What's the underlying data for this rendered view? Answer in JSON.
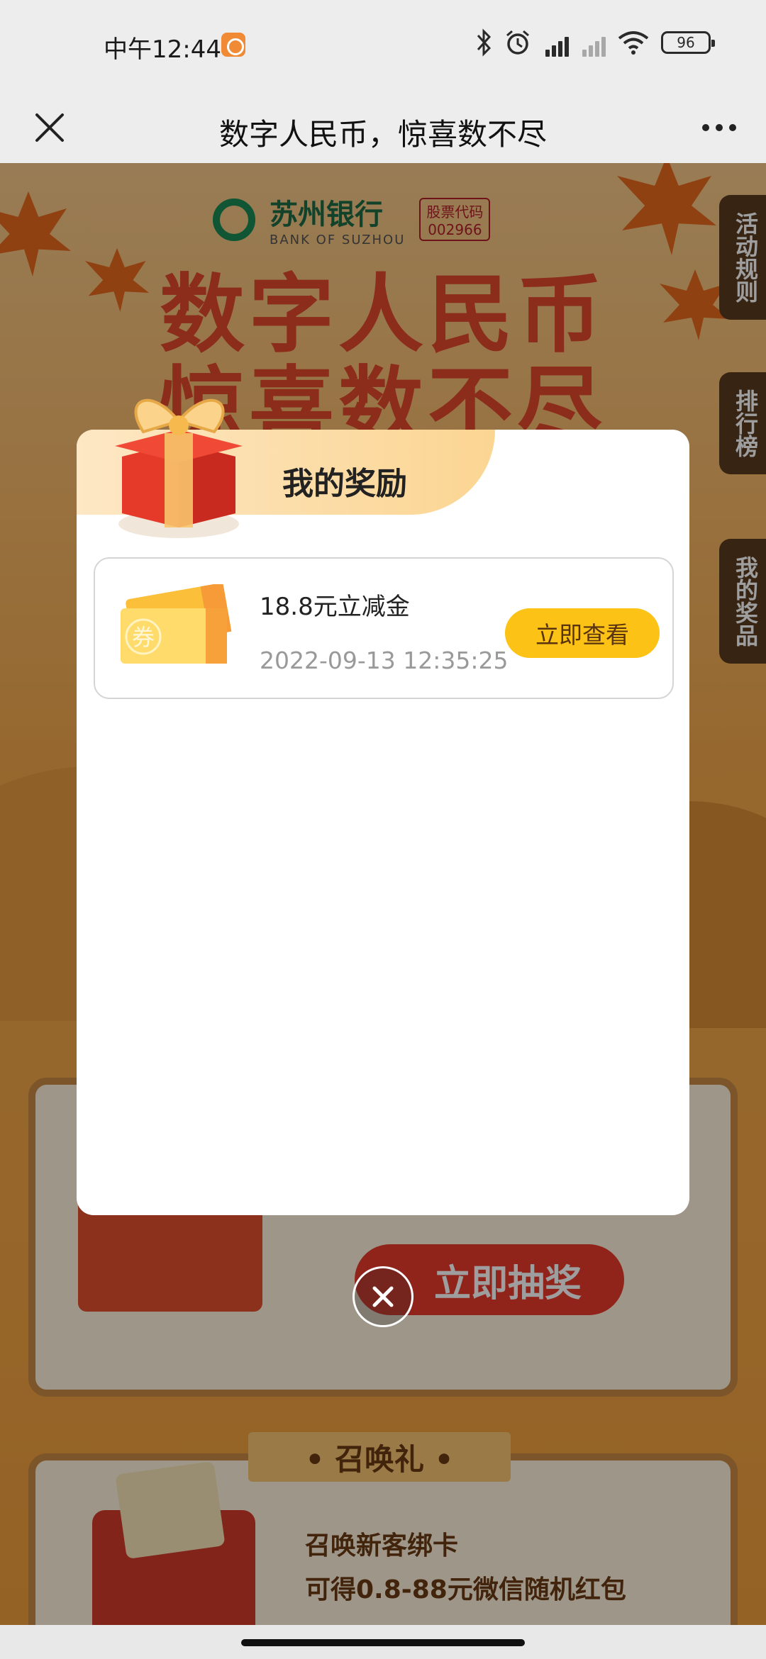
{
  "status_bar": {
    "time": "中午12:44",
    "battery": "96"
  },
  "nav": {
    "title": "数字人民币，惊喜数不尽"
  },
  "background": {
    "bank_name": "苏州银行",
    "bank_name_en": "BANK OF SUZHOU",
    "stock_label": "股票代码",
    "stock_code": "002966",
    "hero_title_line1": "数字人民币",
    "hero_title_line2": "惊喜数不尽",
    "side_tabs": [
      "活动规则",
      "排行榜",
      "我的奖品"
    ],
    "draw_button": "立即抽奖",
    "section_title": "• 召唤礼 •",
    "section_desc_line1": "召唤新客绑卡",
    "section_desc_line2": "可得0.8-88元微信随机红包"
  },
  "modal": {
    "title": "我的奖励",
    "rewards": [
      {
        "name": "18.8元立减金",
        "time": "2022-09-13 12:35:25",
        "button": "立即查看",
        "coupon_char": "券"
      }
    ]
  },
  "colors": {
    "accent_yellow": "#fcc216",
    "header_gradient": "#fbd592",
    "bg_orange": "#f2a545"
  }
}
